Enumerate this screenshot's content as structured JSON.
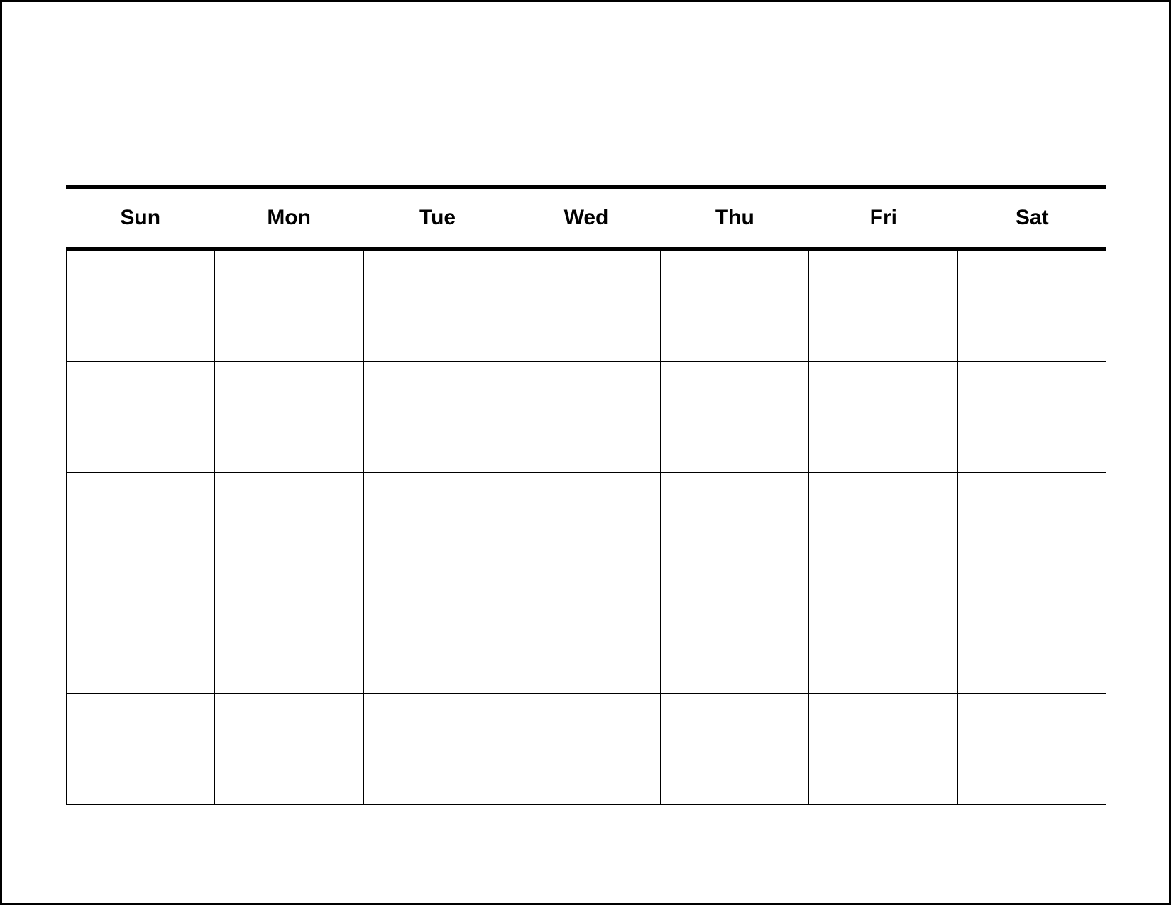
{
  "calendar": {
    "days": [
      "Sun",
      "Mon",
      "Tue",
      "Wed",
      "Thu",
      "Fri",
      "Sat"
    ],
    "rows": 5,
    "columns": 7
  }
}
